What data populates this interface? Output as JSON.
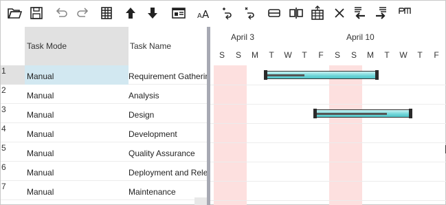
{
  "toolbar": {
    "icons": [
      "open-folder-icon",
      "save-icon",
      "undo-icon",
      "redo-icon",
      "grid-columns-icon",
      "move-up-icon",
      "move-down-icon",
      "window-icon",
      "font-size-icon",
      "link-tasks-icon",
      "unlink-tasks-icon",
      "split-icon",
      "center-split-icon",
      "calendar-icon",
      "delete-icon",
      "outdent-icon",
      "indent-icon",
      "page-icon"
    ]
  },
  "grid": {
    "headers": {
      "mode": "Task Mode",
      "name": "Task Name"
    },
    "rows": [
      {
        "num": "1",
        "mode": "Manual",
        "name": "Requirement Gathering"
      },
      {
        "num": "2",
        "mode": "Manual",
        "name": "Analysis"
      },
      {
        "num": "3",
        "mode": "Manual",
        "name": "Design"
      },
      {
        "num": "4",
        "mode": "Manual",
        "name": "Development"
      },
      {
        "num": "5",
        "mode": "Manual",
        "name": "Quality Assurance"
      },
      {
        "num": "6",
        "mode": "Manual",
        "name": "Deployment and Release"
      },
      {
        "num": "7",
        "mode": "Manual",
        "name": "Maintenance"
      }
    ]
  },
  "chart": {
    "weeks": [
      "April 3",
      "April 10"
    ],
    "days": [
      "S",
      "S",
      "M",
      "T",
      "W",
      "T",
      "F",
      "S",
      "S",
      "M",
      "T",
      "W",
      "T",
      "F"
    ],
    "colors": {
      "weekend": "#fde0df",
      "bar": "#6fd5d8",
      "selected_row": "#d2e8f1"
    }
  }
}
